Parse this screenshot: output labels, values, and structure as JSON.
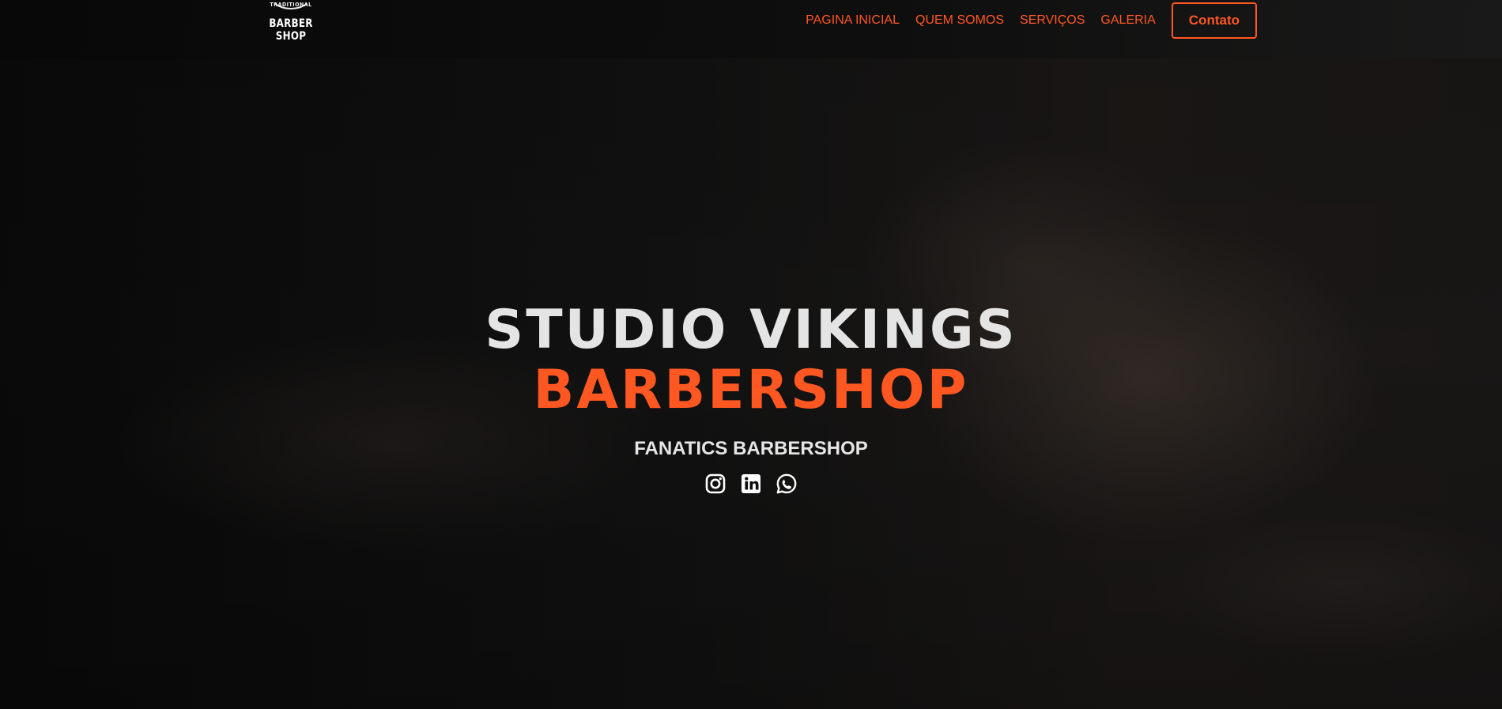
{
  "logo": {
    "top_text": "TRADITIONAL",
    "main_text": "BARBER SHOP"
  },
  "nav": {
    "links": [
      "PAGINA INICIAL",
      "QUEM SOMOS",
      "SERVIÇOS",
      "GALERIA"
    ],
    "contact_label": "Contato"
  },
  "hero": {
    "title_line1": "STUDIO VIKINGS",
    "title_line2": "BARBERSHOP",
    "subtitle": "FANATICS BARBERSHOP",
    "socials": [
      "instagram-icon",
      "linkedin-icon",
      "whatsapp-icon"
    ]
  },
  "colors": {
    "accent": "#ff5722",
    "title_light": "#e4e4e4",
    "background": "#0b0b0b"
  }
}
